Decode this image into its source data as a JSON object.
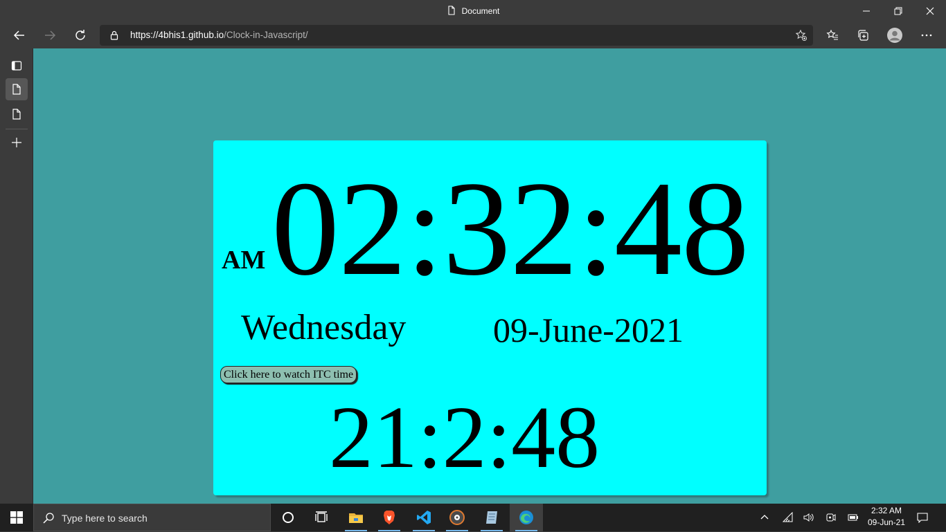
{
  "window": {
    "title": "Document"
  },
  "browser": {
    "url_host": "https://4bhis1.github.io",
    "url_path": "/Clock-in-Javascript/"
  },
  "clock": {
    "ampm": "AM",
    "time": "02:32:48",
    "day": "Wednesday",
    "date": "09-June-2021",
    "itc_button_label": "Click here to watch ITC time",
    "itc_time": "21:2:48"
  },
  "colors": {
    "page_background": "#3f9ea0",
    "card_background": "#00ffff",
    "button_background": "#8dbfb0"
  },
  "taskbar": {
    "search_placeholder": "Type here to search",
    "time": "2:32 AM",
    "date": "09-Jun-21",
    "apps": [
      "cortana-icon",
      "task-view-icon",
      "file-explorer-icon",
      "brave-icon",
      "vscode-icon",
      "media-player-icon",
      "notepad-icon",
      "edge-icon"
    ]
  }
}
